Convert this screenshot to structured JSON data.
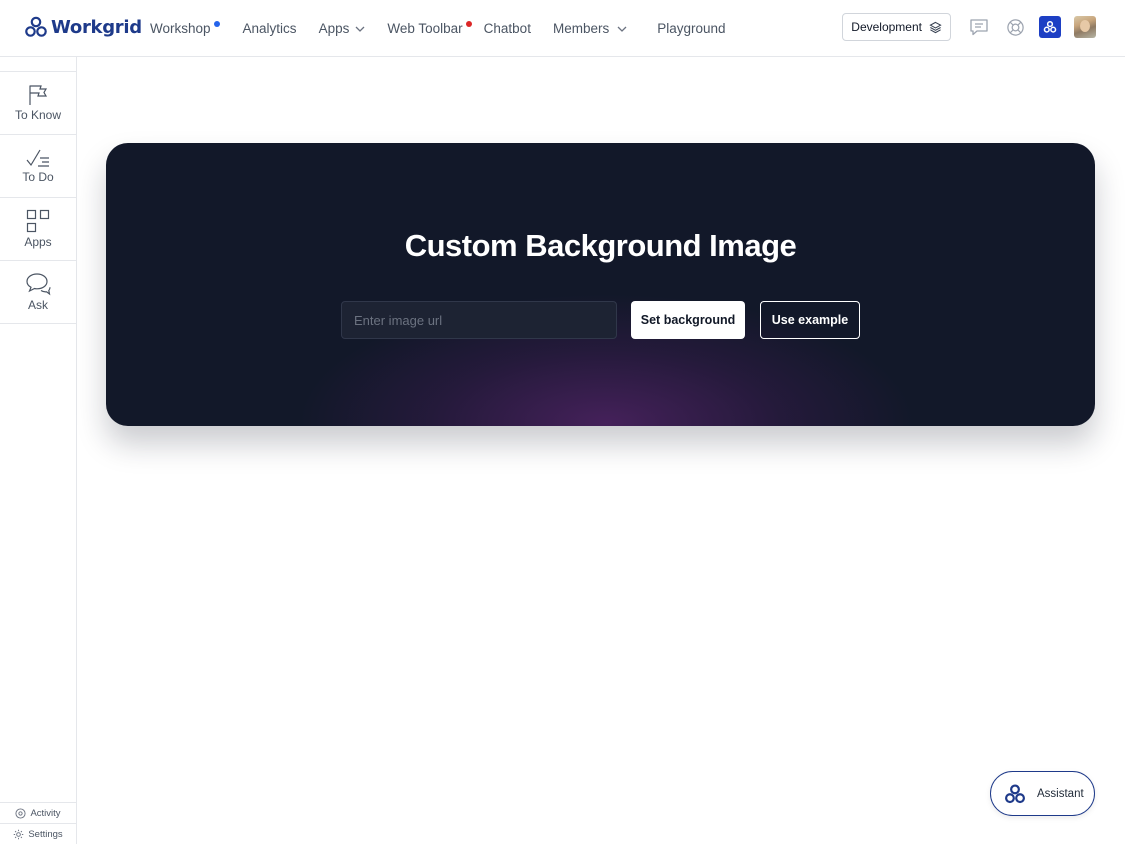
{
  "brand": {
    "name": "Workgrid",
    "color": "#1e3a8a"
  },
  "nav": {
    "items": [
      {
        "label": "Workshop",
        "dot": "#2563eb"
      },
      {
        "label": "Analytics"
      },
      {
        "label": "Apps",
        "dropdown": true
      },
      {
        "label": "Web Toolbar",
        "dot": "#dc2626"
      },
      {
        "label": "Chatbot"
      },
      {
        "label": "Members",
        "dropdown": true
      },
      {
        "label": "Playground"
      }
    ],
    "environment_label": "Development",
    "icons": [
      "chat-bubble-icon",
      "help-lifebuoy-icon",
      "workgrid-app-icon",
      "user-avatar"
    ]
  },
  "sidebar": {
    "items": [
      {
        "label": "To Know",
        "icon": "flag-icon"
      },
      {
        "label": "To Do",
        "icon": "checklist-icon"
      },
      {
        "label": "Apps",
        "icon": "grid-icon"
      },
      {
        "label": "Ask",
        "icon": "chat-bubbles-icon"
      }
    ],
    "bottom": [
      {
        "label": "Activity",
        "icon": "activity-icon"
      },
      {
        "label": "Settings",
        "icon": "gear-icon"
      }
    ]
  },
  "hero": {
    "title": "Custom Background Image",
    "input_placeholder": "Enter image url",
    "input_value": "",
    "set_button": "Set background",
    "example_button": "Use example",
    "background_color": "#121829"
  },
  "assistant": {
    "label": "Assistant"
  }
}
